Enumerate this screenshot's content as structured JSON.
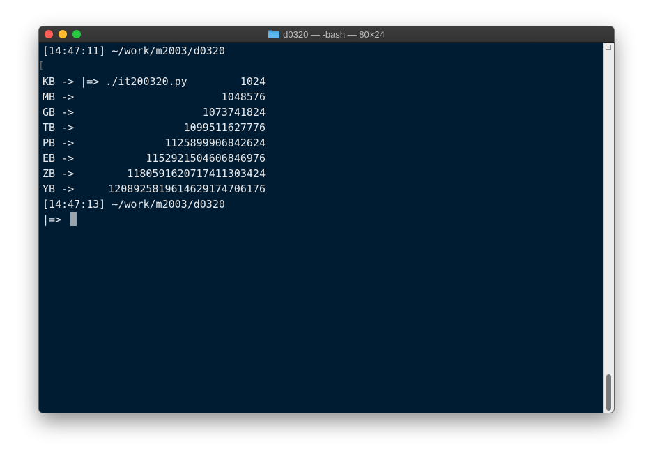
{
  "window": {
    "title": "d0320 — -bash — 80×24",
    "folder_icon": "folder-icon"
  },
  "terminal": {
    "prompt1": "[14:47:11] ~/work/m2003/d0320",
    "command_line": "|=> ./it200320.py",
    "rows": [
      {
        "unit": "KB ->",
        "value": "1024"
      },
      {
        "unit": "MB ->",
        "value": "1048576"
      },
      {
        "unit": "GB ->",
        "value": "1073741824"
      },
      {
        "unit": "TB ->",
        "value": "1099511627776"
      },
      {
        "unit": "PB ->",
        "value": "1125899906842624"
      },
      {
        "unit": "EB ->",
        "value": "1152921504606846976"
      },
      {
        "unit": "ZB ->",
        "value": "1180591620717411303424"
      },
      {
        "unit": "YB ->",
        "value": "1208925819614629174706176"
      }
    ],
    "prompt2": "[14:47:13] ~/work/m2003/d0320",
    "input_prompt": "|=> "
  },
  "colors": {
    "background": "#001c33",
    "foreground": "#e8e8e8",
    "cursor": "#9aa4ab"
  }
}
